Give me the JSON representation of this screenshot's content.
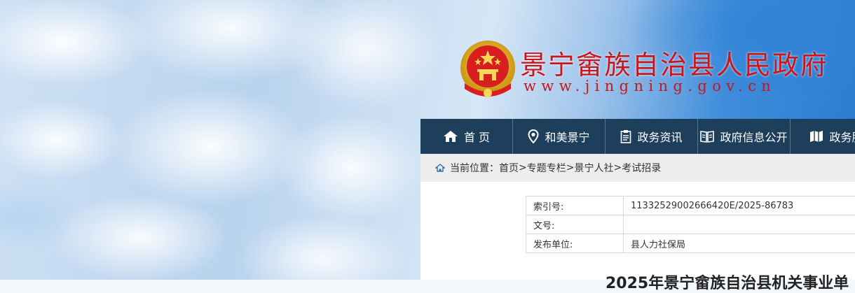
{
  "header": {
    "title": "景宁畲族自治县人民政府",
    "url": "www.jingning.gov.cn",
    "colors": {
      "title": "#c8161d",
      "nav_bg": "#1e3f5c"
    }
  },
  "nav": {
    "items": [
      {
        "label": "首 页",
        "icon": "home-icon"
      },
      {
        "label": "和美景宁",
        "icon": "location-pin-icon"
      },
      {
        "label": "政务资讯",
        "icon": "clipboard-icon"
      },
      {
        "label": "政府信息公开",
        "icon": "open-book-icon"
      },
      {
        "label": "政务服",
        "icon": "map-icon"
      }
    ]
  },
  "breadcrumb": {
    "prefix": "当前位置：",
    "items": [
      "首页",
      "专题专栏",
      "景宁人社",
      "考试招录"
    ],
    "separator": ">"
  },
  "meta": {
    "rows": [
      {
        "label": "索引号:",
        "value": "11332529002666420E/2025-86783"
      },
      {
        "label": "文号:",
        "value": ""
      },
      {
        "label": "发布单位:",
        "value": "县人力社保局"
      }
    ]
  },
  "article": {
    "title": "2025年景宁畲族自治县机关事业单"
  }
}
